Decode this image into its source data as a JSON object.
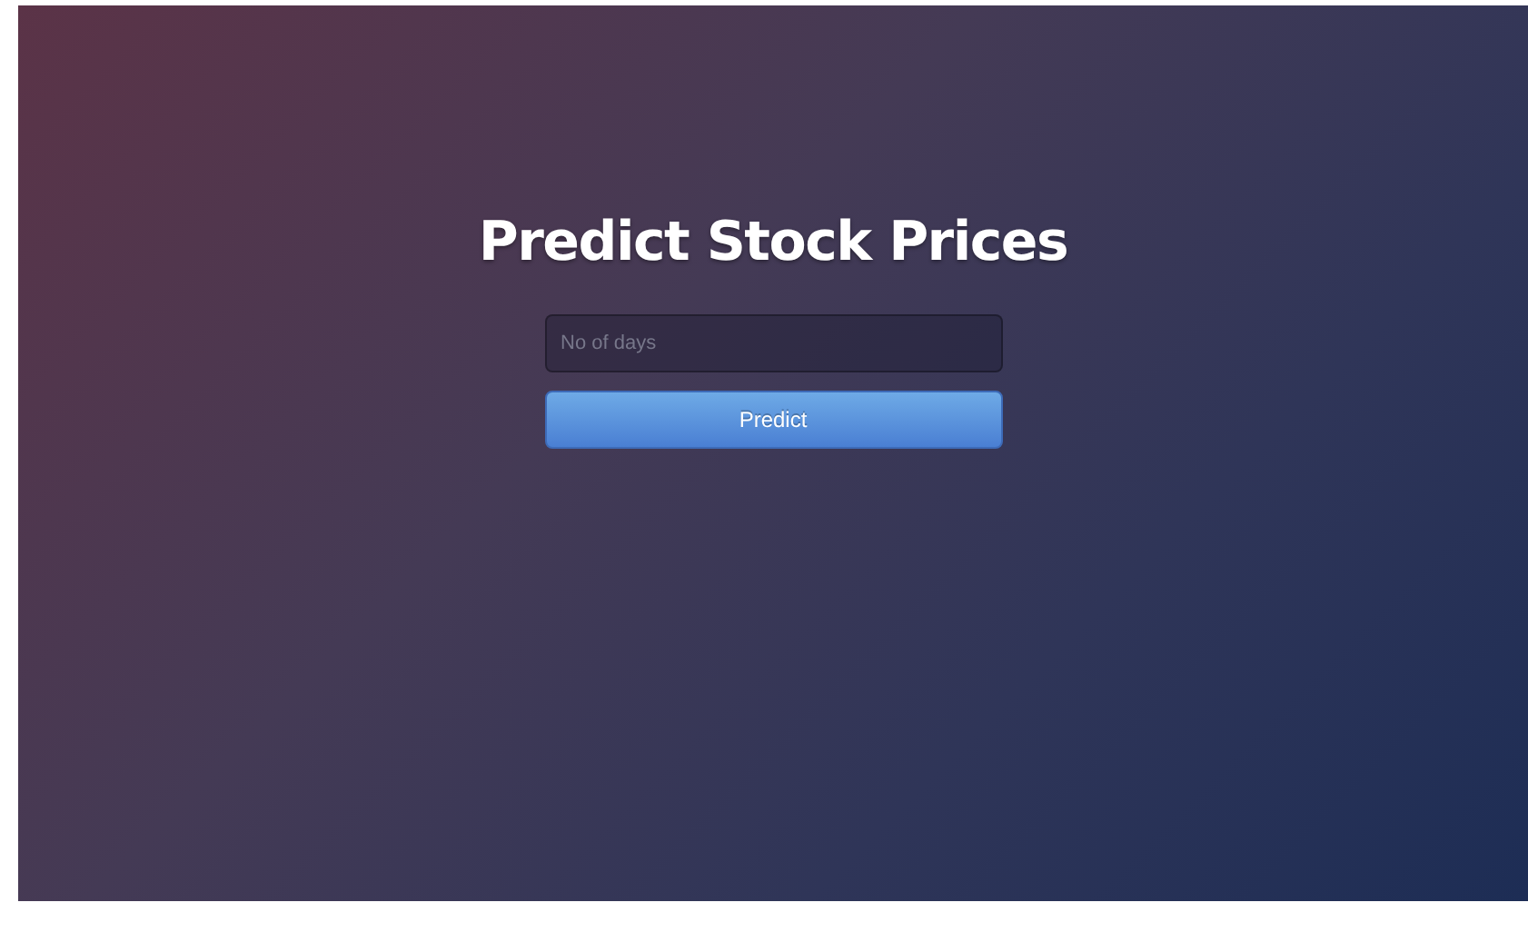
{
  "title": "Predict Stock Prices",
  "days_field": {
    "placeholder": "No of days"
  },
  "predict_button": {
    "label": "Predict"
  }
}
